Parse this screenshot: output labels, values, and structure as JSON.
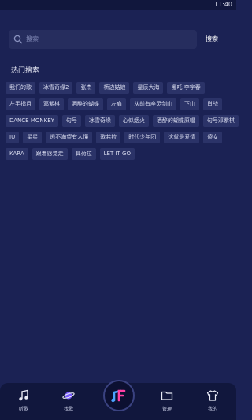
{
  "status": {
    "time": "11:40"
  },
  "search": {
    "placeholder": "搜索",
    "button_label": "搜索"
  },
  "hot": {
    "title": "热门搜索",
    "rows": [
      [
        "我们的歌",
        "冰雪奇缘2",
        "张杰",
        "桥边姑娘",
        "星辰大海",
        "哪吒 李宇春"
      ],
      [
        "左手指月",
        "邓紫棋",
        "酒醉的蝴蝶",
        "左肩",
        "从前有座灵剑山",
        "下山",
        "肖战"
      ],
      [
        "DANCE MONKEY",
        "句号",
        "冰雪奇缘",
        "心似烟火",
        "酒醉的蝴蝶原唱",
        "句号邓紫棋"
      ],
      [
        "IU",
        "星星",
        "逃不滿望有人懂",
        "歌若拉",
        "时代少年团",
        "这就是爱情",
        "傻女"
      ],
      [
        "KARA",
        "跟着感觉走",
        "具荷拉",
        "LET IT GO"
      ]
    ]
  },
  "nav": {
    "items": [
      {
        "label": "听歌",
        "icon": "music-note-icon"
      },
      {
        "label": "找歌",
        "icon": "planet-icon"
      },
      {
        "label": "",
        "icon": "app-logo-icon"
      },
      {
        "label": "管理",
        "icon": "folder-icon"
      },
      {
        "label": "我的",
        "icon": "tshirt-icon"
      }
    ]
  },
  "colors": {
    "background": "#1b2254",
    "tag": "#2b3368",
    "nav": "#11173d"
  }
}
